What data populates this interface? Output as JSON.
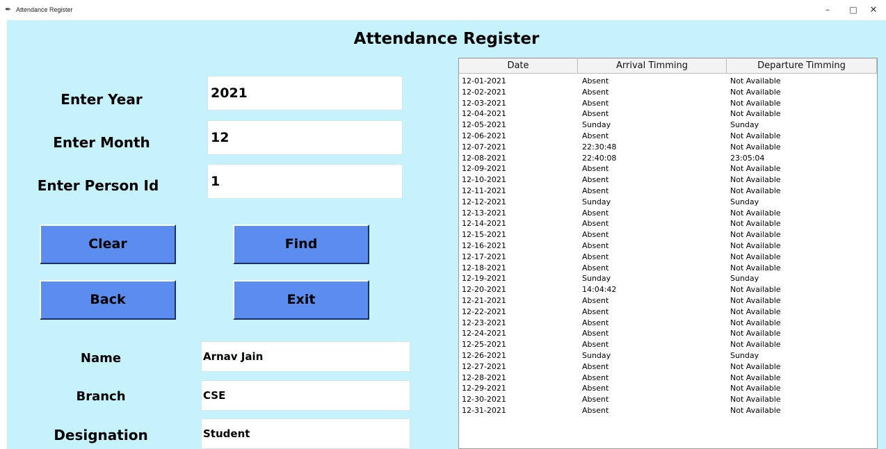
{
  "window": {
    "title": "Attendance Register",
    "minimize": "–",
    "maximize": "□",
    "close": "✕"
  },
  "heading": "Attendance Register",
  "form": {
    "year_label": "Enter Year",
    "year_value": "2021",
    "month_label": "Enter Month",
    "month_value": "12",
    "person_label": "Enter Person Id",
    "person_value": "1"
  },
  "buttons": {
    "clear": "Clear",
    "find": "Find",
    "back": "Back",
    "exit": "Exit"
  },
  "details": {
    "name_label": "Name",
    "name_value": "Arnav Jain",
    "branch_label": "Branch",
    "branch_value": "CSE",
    "designation_label": "Designation",
    "designation_value": "Student"
  },
  "table": {
    "columns": [
      "Date",
      "Arrival Timming",
      "Departure Timming"
    ],
    "rows": [
      [
        "12-01-2021",
        "Absent",
        "Not Available"
      ],
      [
        "12-02-2021",
        "Absent",
        "Not Available"
      ],
      [
        "12-03-2021",
        "Absent",
        "Not Available"
      ],
      [
        "12-04-2021",
        "Absent",
        "Not Available"
      ],
      [
        "12-05-2021",
        "Sunday",
        "Sunday"
      ],
      [
        "12-06-2021",
        "Absent",
        "Not Available"
      ],
      [
        "12-07-2021",
        "22:30:48",
        "Not Available"
      ],
      [
        "12-08-2021",
        "22:40:08",
        "23:05:04"
      ],
      [
        "12-09-2021",
        "Absent",
        "Not Available"
      ],
      [
        "12-10-2021",
        "Absent",
        "Not Available"
      ],
      [
        "12-11-2021",
        "Absent",
        "Not Available"
      ],
      [
        "12-12-2021",
        "Sunday",
        "Sunday"
      ],
      [
        "12-13-2021",
        "Absent",
        "Not Available"
      ],
      [
        "12-14-2021",
        "Absent",
        "Not Available"
      ],
      [
        "12-15-2021",
        "Absent",
        "Not Available"
      ],
      [
        "12-16-2021",
        "Absent",
        "Not Available"
      ],
      [
        "12-17-2021",
        "Absent",
        "Not Available"
      ],
      [
        "12-18-2021",
        "Absent",
        "Not Available"
      ],
      [
        "12-19-2021",
        "Sunday",
        "Sunday"
      ],
      [
        "12-20-2021",
        "14:04:42",
        "Not Available"
      ],
      [
        "12-21-2021",
        "Absent",
        "Not Available"
      ],
      [
        "12-22-2021",
        "Absent",
        "Not Available"
      ],
      [
        "12-23-2021",
        "Absent",
        "Not Available"
      ],
      [
        "12-24-2021",
        "Absent",
        "Not Available"
      ],
      [
        "12-25-2021",
        "Absent",
        "Not Available"
      ],
      [
        "12-26-2021",
        "Sunday",
        "Sunday"
      ],
      [
        "12-27-2021",
        "Absent",
        "Not Available"
      ],
      [
        "12-28-2021",
        "Absent",
        "Not Available"
      ],
      [
        "12-29-2021",
        "Absent",
        "Not Available"
      ],
      [
        "12-30-2021",
        "Absent",
        "Not Available"
      ],
      [
        "12-31-2021",
        "Absent",
        "Not Available"
      ]
    ]
  },
  "colors": {
    "background": "#c6f2fb",
    "button": "#5a8dee"
  }
}
